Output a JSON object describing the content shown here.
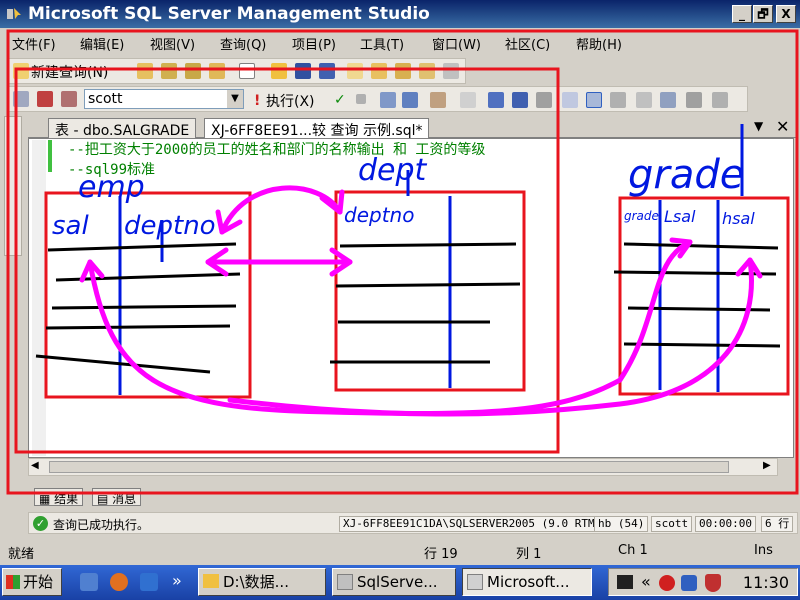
{
  "window": {
    "title": "Microsoft SQL Server Management Studio",
    "minimize": "_",
    "maximize": "🗗",
    "close": "X"
  },
  "menu": [
    "文件(F)",
    "编辑(E)",
    "视图(V)",
    "查询(Q)",
    "项目(P)",
    "工具(T)",
    "窗口(W)",
    "社区(C)",
    "帮助(H)"
  ],
  "toolbar": {
    "new_query": "新建查询(N)",
    "database": "scott",
    "execute": "执行(X)"
  },
  "tabs": [
    {
      "label": "表 - dbo.SALGRADE",
      "active": false
    },
    {
      "label": "XJ-6FF8EE91...较 查询 示例.sql*",
      "active": true
    }
  ],
  "editor": {
    "lines": [
      "--把工资大于2000的员工的姓名和部门的名称输出 和 工资的等级",
      "--sql99标准"
    ]
  },
  "annotations": {
    "emp_title": "emp",
    "emp_cols": [
      "sal",
      "deptno"
    ],
    "dept_title": "dept",
    "dept_cols": [
      "deptno"
    ],
    "grade_title": "grade",
    "grade_cols": [
      "grade",
      "Lsal",
      "hsal"
    ],
    "color_red": "#e8141e",
    "color_magenta": "#ff00ff",
    "color_blue": "#0018e0"
  },
  "results_tabs": [
    "结果",
    "消息"
  ],
  "query_status": {
    "message": "查询已成功执行。",
    "server": "XJ-6FF8EE91C1DA\\SQLSERVER2005 (9.0 RTM)",
    "user": "hb (54)",
    "database": "scott",
    "elapsed": "00:00:00",
    "rows": "6 行"
  },
  "statusbar": {
    "state": "就绪",
    "row": "行 19",
    "col": "列 1",
    "ch": "Ch 1",
    "mode": "Ins"
  },
  "taskbar": {
    "start": "开始",
    "chevron": "»",
    "tasks": [
      {
        "label": "D:\\数据...",
        "active": false
      },
      {
        "label": "SqlServe...",
        "active": false
      },
      {
        "label": "Microsoft...",
        "active": true
      }
    ],
    "tray_chevron": "«",
    "clock": "11:30"
  }
}
